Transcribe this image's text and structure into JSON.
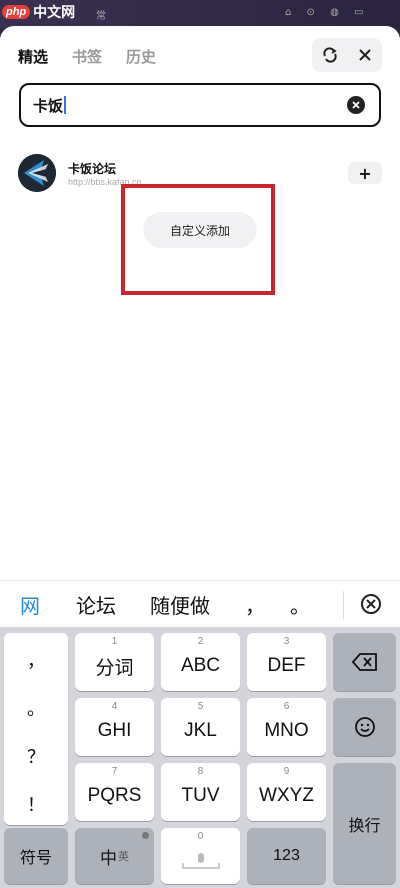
{
  "statusbar": {
    "watermark_logo": "php",
    "watermark_title": "中文网",
    "watermark_sub": "",
    "glyph_left": "常",
    "glyph_right": "⌂ ⊙ ◍ ▭"
  },
  "tabs": [
    {
      "label": "精选"
    },
    {
      "label": "书签"
    },
    {
      "label": "历史"
    }
  ],
  "search": {
    "value": "卡饭"
  },
  "result": {
    "title": "卡饭论坛",
    "url": "http://bbs.kafan.cn",
    "add_label": "+"
  },
  "custom_add_label": "自定义添加",
  "candidates": [
    "网",
    "论坛",
    "随便做",
    "，",
    "。"
  ],
  "keyboard": {
    "punct": [
      "，",
      "。",
      "？",
      "！"
    ],
    "rows": [
      [
        {
          "num": "1",
          "label": "分词"
        },
        {
          "num": "2",
          "label": "ABC"
        },
        {
          "num": "3",
          "label": "DEF"
        }
      ],
      [
        {
          "num": "4",
          "label": "GHI"
        },
        {
          "num": "5",
          "label": "JKL"
        },
        {
          "num": "6",
          "label": "MNO"
        }
      ],
      [
        {
          "num": "7",
          "label": "PQRS"
        },
        {
          "num": "8",
          "label": "TUV"
        },
        {
          "num": "9",
          "label": "WXYZ"
        }
      ]
    ],
    "symbols_label": "符号",
    "lang_label": "中",
    "lang_sub": "英",
    "space_num": "0",
    "num123_label": "123",
    "enter_label": "换行"
  },
  "colors": {
    "accent": "#1f8bd6",
    "highlight_box": "#c7262c"
  }
}
